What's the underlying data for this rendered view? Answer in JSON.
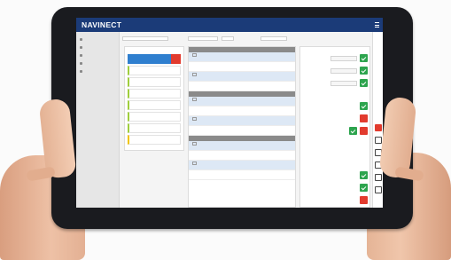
{
  "app": {
    "logo": "NAVINECT",
    "nav": [
      "",
      ""
    ],
    "user": ""
  },
  "sidebar": {
    "items": [
      {
        "label": ""
      },
      {
        "label": ""
      },
      {
        "label": ""
      },
      {
        "label": ""
      },
      {
        "label": ""
      }
    ]
  },
  "filter": {
    "fields": [
      "",
      "",
      "",
      ""
    ]
  },
  "tasks": {
    "title": "",
    "cards": [
      {
        "label": "",
        "selected": true
      },
      {
        "label": ""
      },
      {
        "label": ""
      },
      {
        "label": ""
      },
      {
        "label": ""
      },
      {
        "label": ""
      },
      {
        "label": ""
      },
      {
        "label": ""
      }
    ]
  },
  "sections": [
    {
      "title": ""
    },
    {
      "title": ""
    },
    {
      "title": ""
    }
  ],
  "colors": {
    "header": "#1b3b78",
    "accent_green": "#2da44e",
    "accent_red": "#e23b2e",
    "accent_blue": "#2f7fcf"
  }
}
